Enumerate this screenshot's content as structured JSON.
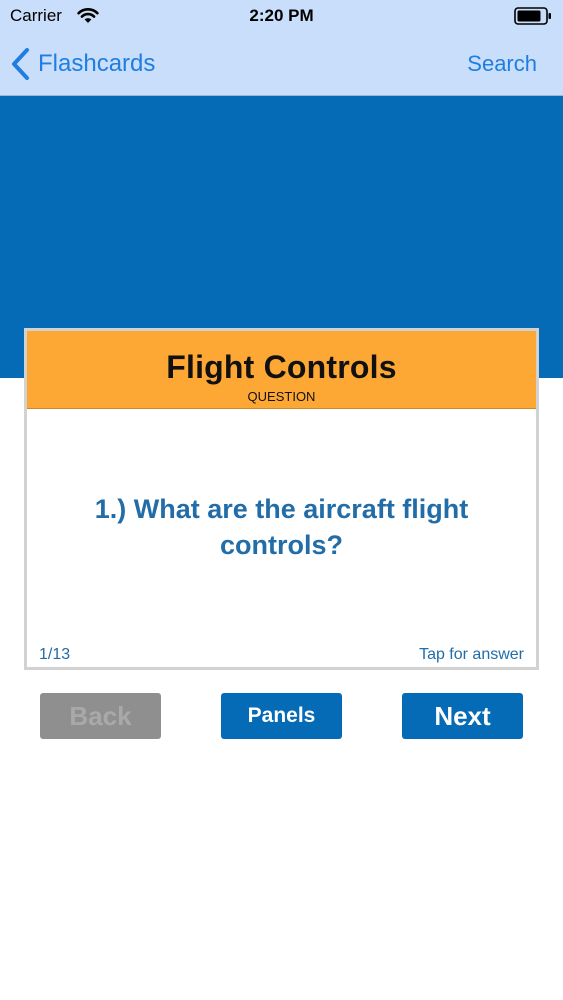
{
  "status_bar": {
    "carrier": "Carrier",
    "time": "2:20 PM"
  },
  "nav": {
    "back_label": "Flashcards",
    "search_label": "Search"
  },
  "card": {
    "title": "Flight Controls",
    "subtitle": "QUESTION",
    "question": "1.) What are the aircraft flight controls?",
    "counter": "1/13",
    "hint": "Tap for answer"
  },
  "buttons": {
    "back": "Back",
    "panels": "Panels",
    "next": "Next"
  },
  "colors": {
    "nav_background": "#c9defa",
    "link_blue": "#1f7ee0",
    "brand_blue": "#066bb7",
    "card_header_orange": "#fda734",
    "question_text": "#226da8",
    "disabled_gray": "#8f8f8f"
  },
  "icons": {
    "wifi": "wifi-icon",
    "battery": "battery-icon",
    "back_chevron": "chevron-left-icon"
  }
}
